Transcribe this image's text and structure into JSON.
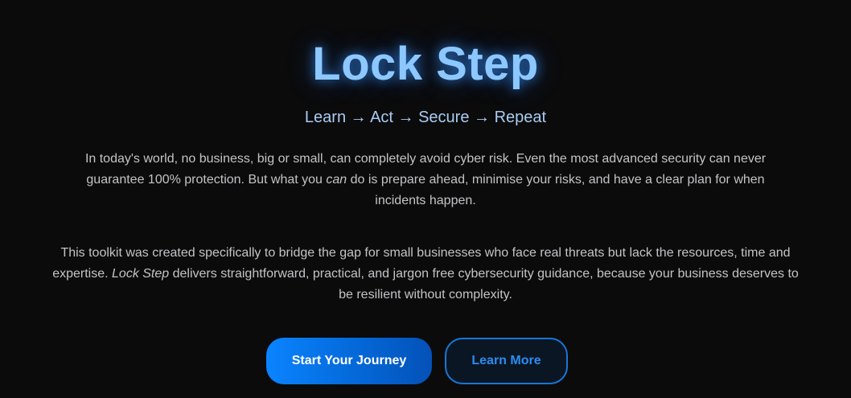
{
  "hero": {
    "title": "Lock Step",
    "tagline": "Learn → Act → Secure → Repeat",
    "paragraph1": {
      "before_em": "In today's world, no business, big or small, can completely avoid cyber risk. Even the most advanced security can never guarantee 100% protection. But what you ",
      "em": "can",
      "after_em": " do is prepare ahead, minimise your risks, and have a clear plan for when incidents happen."
    },
    "paragraph2": {
      "before_em": "This toolkit was created specifically to bridge the gap for small businesses who face real threats but lack the resources, time and expertise. ",
      "em": "Lock Step",
      "after_em": " delivers straightforward, practical, and jargon free cybersecurity guidance, because your business deserves to be resilient without complexity."
    },
    "primary_button": "Start Your Journey",
    "secondary_button": "Learn More"
  },
  "colors": {
    "background": "#0b0b0c",
    "title": "#8cc8ff",
    "accent": "#0a84ff",
    "secondary_text": "#2b8cf0"
  }
}
